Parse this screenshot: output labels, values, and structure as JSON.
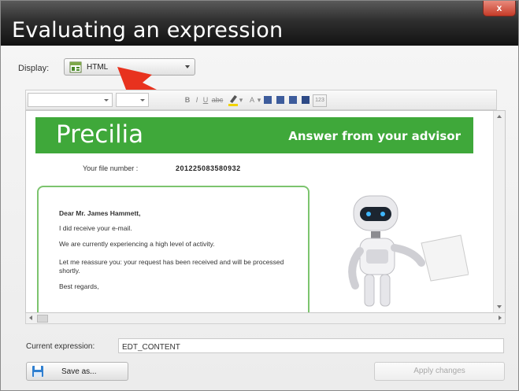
{
  "window": {
    "title": "Evaluating an expression",
    "close_label": "x"
  },
  "display": {
    "label": "Display:",
    "selected": "HTML",
    "icon": "html-page-icon"
  },
  "annotation": {
    "icon": "red-arrow-pointer",
    "color": "#e8321e"
  },
  "toolbar": {
    "strike_label": "abc",
    "underline_label": "U",
    "text_color_label": "A",
    "extra_label": "123",
    "items": [
      "font-name-dropdown",
      "font-size-dropdown",
      "bold",
      "italic",
      "underline",
      "strikethrough",
      "highlight-color",
      "text-color",
      "align-left",
      "align-center",
      "align-right",
      "justify",
      "special-chars"
    ]
  },
  "document": {
    "brand": "Precilia",
    "banner_right": "Answer from your advisor",
    "file_label": "Your file number :",
    "file_number": "201225083580932",
    "greeting": "Dear Mr. James Hammett,",
    "line1": "I did receive your e-mail.",
    "line2": "We are currently experiencing a high level of activity.",
    "line3": "Let me reassure you: your request has been received and will be processed shortly.",
    "closing": "Best regards,",
    "accent_color": "#3fa83a"
  },
  "expression": {
    "label": "Current expression:",
    "value": "EDT_CONTENT"
  },
  "buttons": {
    "save": "Save as...",
    "apply": "Apply changes"
  }
}
